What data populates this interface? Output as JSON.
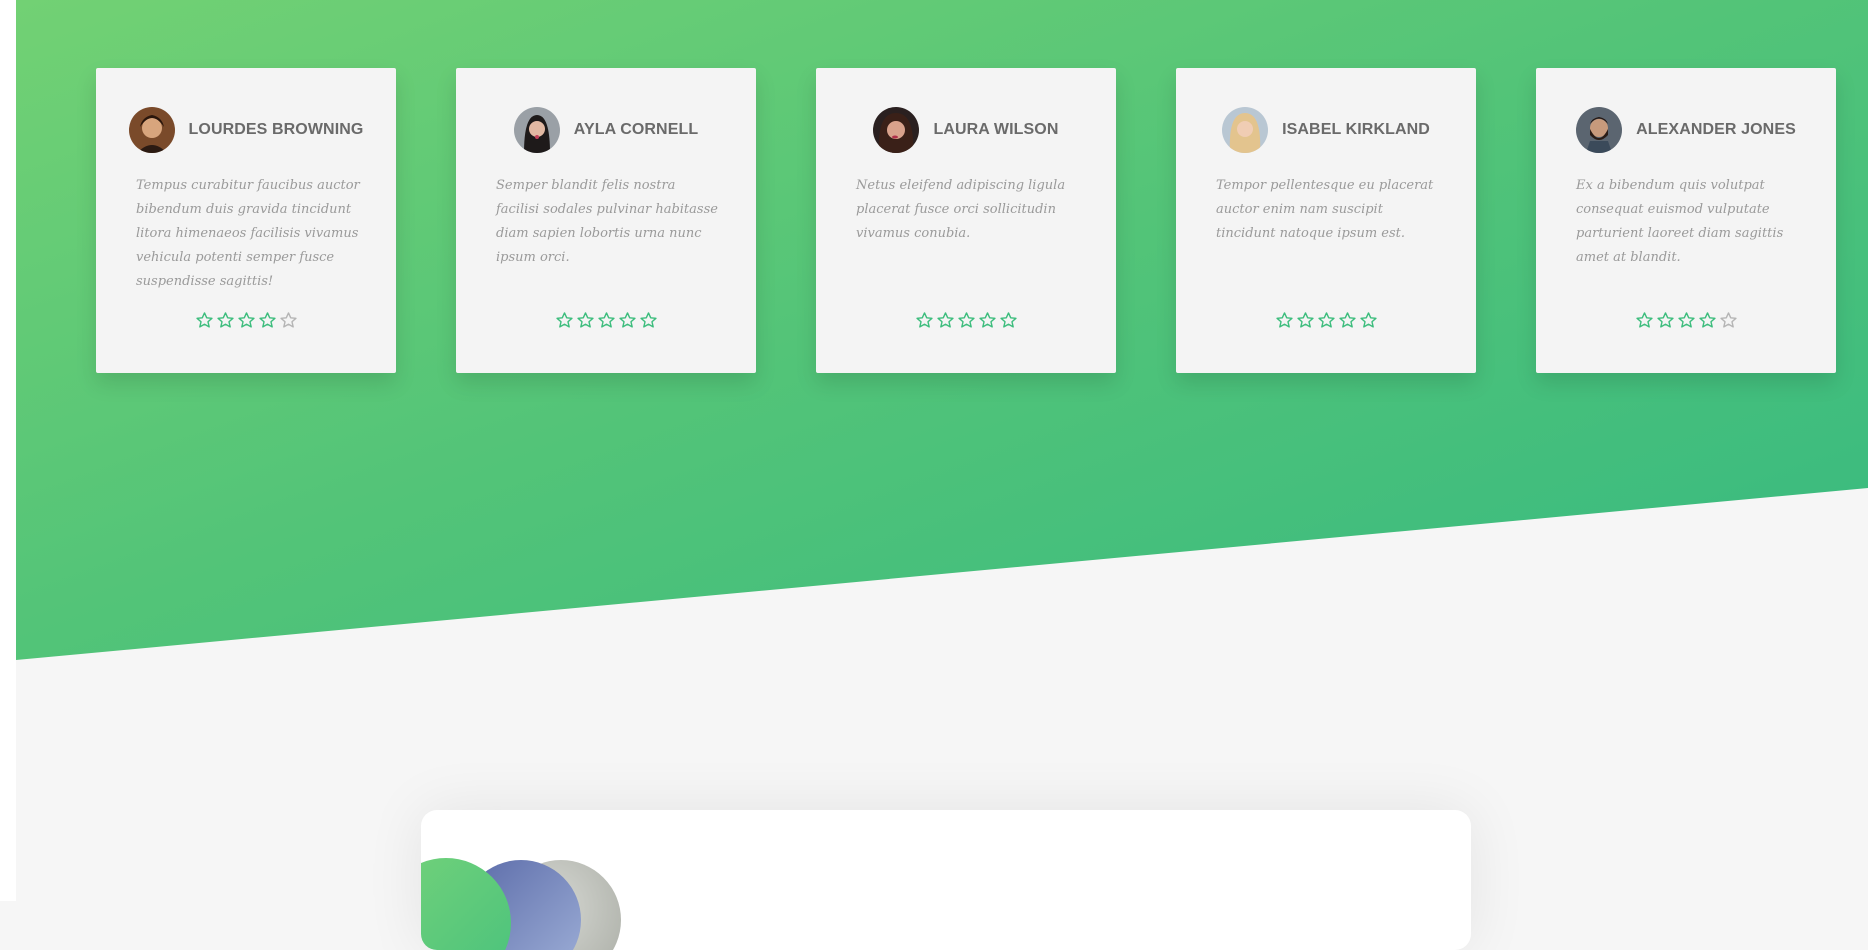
{
  "theme": {
    "accent": "#3dbd7d",
    "star_empty": "#b5b5b5"
  },
  "testimonials": [
    {
      "name": "LOURDES BROWNING",
      "text": "Tempus curabitur faucibus auctor bibendum duis gravida tincidunt litora himenaeos facilisis vivamus vehicula potenti semper fusce suspendisse sagittis!",
      "rating": 4
    },
    {
      "name": "AYLA CORNELL",
      "text": "Semper blandit felis nostra facilisi sodales pulvinar habitasse diam sapien lobortis urna nunc ipsum orci.",
      "rating": 5
    },
    {
      "name": "LAURA WILSON",
      "text": "Netus eleifend adipiscing ligula placerat fusce orci sollicitudin vivamus conubia.",
      "rating": 5
    },
    {
      "name": "ISABEL KIRKLAND",
      "text": "Tempor pellentesque eu placerat auctor enim nam suscipit tincidunt natoque ipsum est.",
      "rating": 5
    },
    {
      "name": "ALEXANDER JONES",
      "text": "Ex a bibendum quis volutpat consequat euismod vulputate parturient laoreet diam sagittis amet at blandit.",
      "rating": 4
    }
  ]
}
